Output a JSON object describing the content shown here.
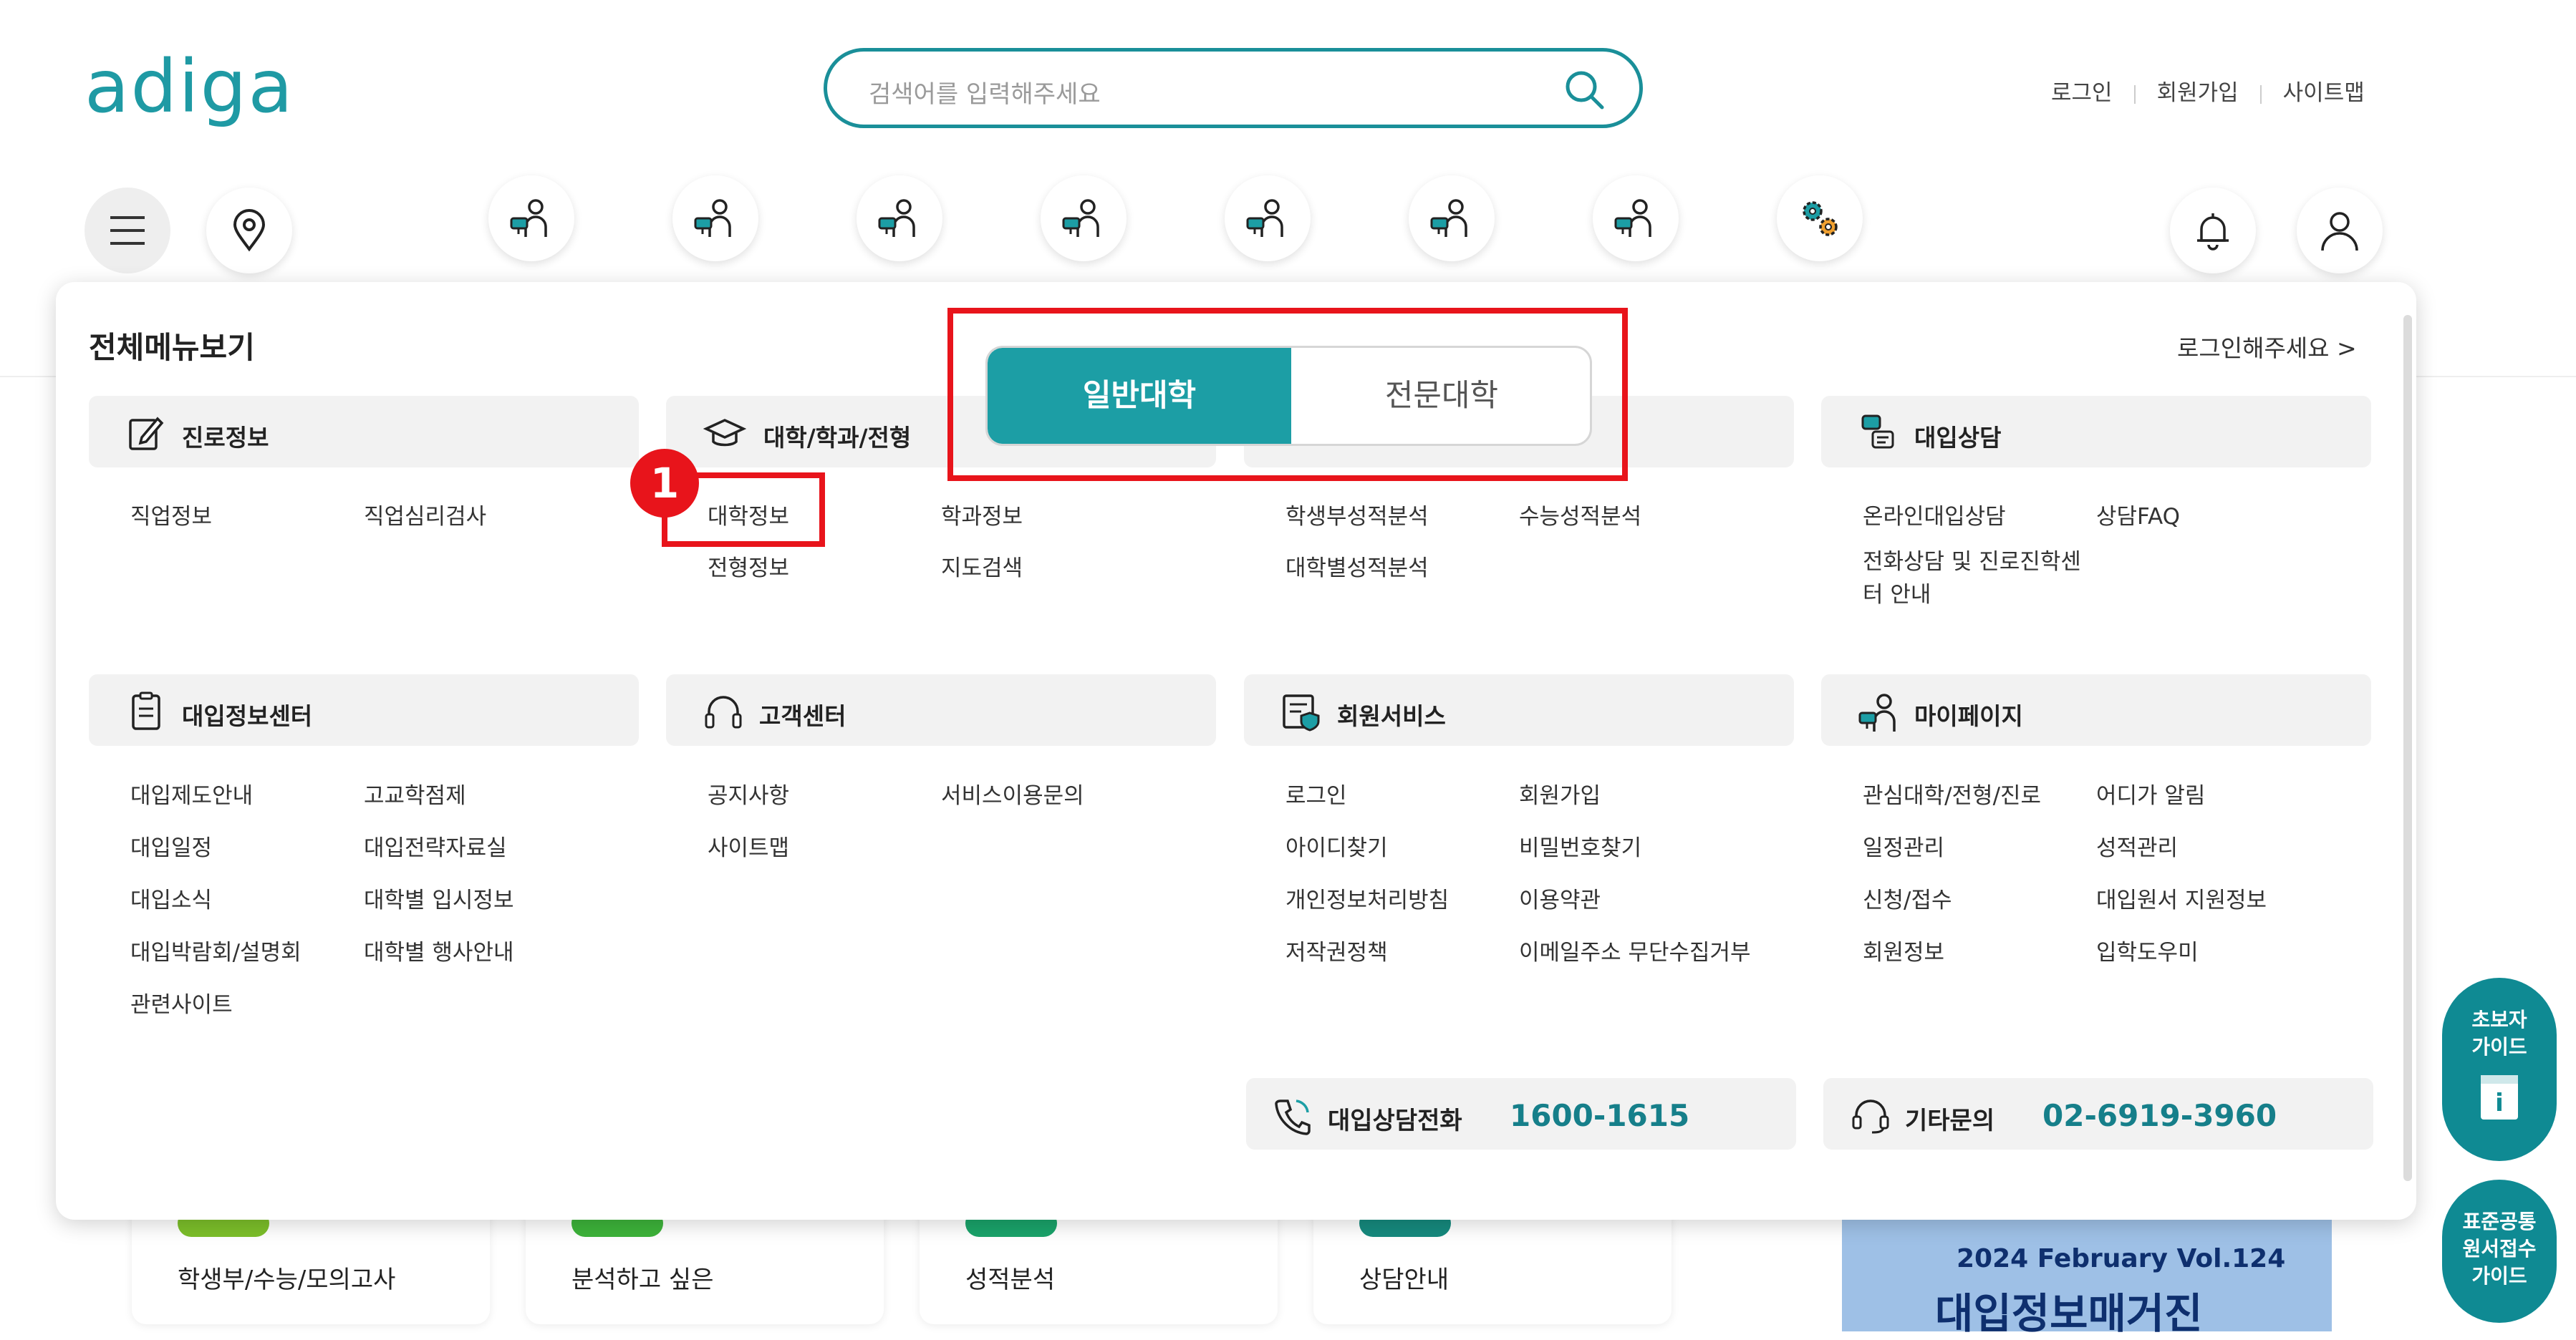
{
  "logo": "adiga",
  "search": {
    "placeholder": "검색어를 입력해주세요"
  },
  "top_links": [
    "로그인",
    "회원가입",
    "사이트맵"
  ],
  "icons": [
    "menu-icon",
    "location-icon",
    "person-chat-icon",
    "gear-icon",
    "bell-icon",
    "user-icon"
  ],
  "panel": {
    "title": "전체메뉴보기",
    "login_prompt": "로그인해주세요 >"
  },
  "toggle": {
    "active": "일반대학",
    "inactive": "전문대학"
  },
  "badge": "1",
  "sections": [
    {
      "label": "진로정보",
      "items": [
        "직업정보",
        "직업심리검사"
      ]
    },
    {
      "label": "대학/학과/전형",
      "items": [
        "대학정보",
        "학과정보",
        "전형정보",
        "지도검색"
      ]
    },
    {
      "label": "",
      "items": [
        "학생부성적분석",
        "수능성적분석",
        "대학별성적분석"
      ]
    },
    {
      "label": "대입상담",
      "items": [
        "온라인대입상담",
        "상담FAQ",
        "전화상담 및 진로진학센터 안내"
      ]
    },
    {
      "label": "대입정보센터",
      "items": [
        "대입제도안내",
        "고교학점제",
        "대입일정",
        "대입전략자료실",
        "대입소식",
        "대학별 입시정보",
        "대입박람회/설명회",
        "대학별 행사안내",
        "관련사이트"
      ]
    },
    {
      "label": "고객센터",
      "items": [
        "공지사항",
        "서비스이용문의",
        "사이트맵"
      ]
    },
    {
      "label": "회원서비스",
      "items": [
        "로그인",
        "회원가입",
        "아이디찾기",
        "비밀번호찾기",
        "개인정보처리방침",
        "이용약관",
        "저작권정책",
        "이메일주소 무단수집거부"
      ]
    },
    {
      "label": "마이페이지",
      "items": [
        "관심대학/전형/진로",
        "어디가 알림",
        "일정관리",
        "성적관리",
        "신청/접수",
        "대입원서 지원정보",
        "회원정보",
        "입학도우미"
      ]
    }
  ],
  "contacts": [
    {
      "label": "대입상담전화",
      "number": "1600-1615"
    },
    {
      "label": "기타문의",
      "number": "02-6919-3960"
    }
  ],
  "floating": [
    {
      "label": "초보자\n가이드",
      "line1": "초보자",
      "line2": "가이드"
    },
    {
      "line1": "표준공통",
      "line2": "원서접수",
      "line3": "가이드"
    }
  ],
  "cards": [
    {
      "line1": "학생부/수능/모의고사"
    },
    {
      "line1": "분석하고 싶은"
    },
    {
      "line1": "성적분석"
    },
    {
      "line1": "상담안내"
    }
  ],
  "magazine": {
    "line1": "2024 February Vol.124",
    "line2": "대입정보매거진"
  },
  "colors": {
    "brand": "#1f9aa4",
    "toggle_active": "#1c9ea5",
    "highlight": "#e8141b",
    "number": "#167f8a"
  }
}
